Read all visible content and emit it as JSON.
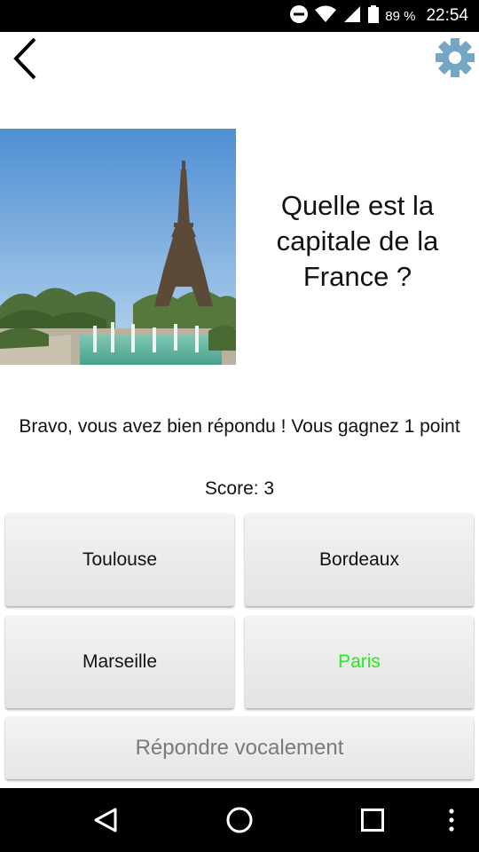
{
  "status_bar": {
    "battery_percent": "89 %",
    "time": "22:54",
    "icons": [
      "do-not-disturb-icon",
      "wifi-icon",
      "signal-icon",
      "battery-icon"
    ]
  },
  "toolbar": {
    "back_icon": "back-arrow-icon",
    "settings_icon": "gear-icon"
  },
  "question": {
    "image": "eiffel-tower-photo",
    "text": "Quelle est la capitale de la France ?"
  },
  "feedback": {
    "message": "Bravo, vous avez bien répondu ! Vous gagnez 1 point",
    "score": "Score: 3"
  },
  "answers": [
    {
      "label": "Toulouse",
      "correct": false
    },
    {
      "label": "Bordeaux",
      "correct": false
    },
    {
      "label": "Marseille",
      "correct": false
    },
    {
      "label": "Paris",
      "correct": true
    }
  ],
  "voice_button": {
    "label": "Répondre vocalement",
    "enabled": false
  },
  "colors": {
    "correct_answer": "#22ee22",
    "settings_icon": "#74a7c4",
    "disabled_text": "#7a7a7a"
  },
  "nav_bar": {
    "icons": [
      "nav-back-icon",
      "nav-home-icon",
      "nav-recents-icon",
      "overflow-menu-icon"
    ]
  }
}
